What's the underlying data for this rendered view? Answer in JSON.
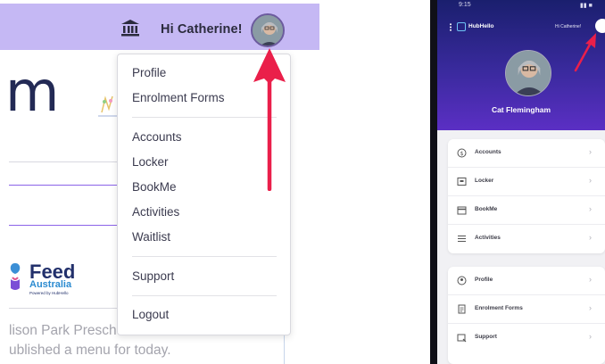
{
  "desktop": {
    "greeting": "Hi Catherine!",
    "logo_partial": "m",
    "feed": {
      "title": "Feed",
      "subtitle": "Australia",
      "powered": "Powered by HubHello"
    },
    "menu_note_line1": "lison Park Preschool has not",
    "menu_note_line2": "ublished a menu for today.",
    "dropdown": {
      "items_group1": [
        "Profile",
        "Enrolment Forms"
      ],
      "items_group2": [
        "Accounts",
        "Locker",
        "BookMe",
        "Activities",
        "Waitlist"
      ],
      "items_group3": [
        "Support"
      ],
      "items_group4": [
        "Logout"
      ]
    }
  },
  "phone": {
    "status_time": "9:15",
    "status_icons": "▮▮ ■",
    "app_name": "HubHello",
    "greeting": "Hi Catherine!",
    "user_name": "Cat Flemingham",
    "card1": [
      {
        "label": "Accounts",
        "icon": "dollar-circle-icon"
      },
      {
        "label": "Locker",
        "icon": "locker-icon"
      },
      {
        "label": "BookMe",
        "icon": "calendar-icon"
      },
      {
        "label": "Activities",
        "icon": "list-icon"
      }
    ],
    "card2": [
      {
        "label": "Profile",
        "icon": "user-circle-icon"
      },
      {
        "label": "Enrolment Forms",
        "icon": "form-icon"
      },
      {
        "label": "Support",
        "icon": "support-icon"
      }
    ],
    "chevron": "›"
  },
  "colors": {
    "topbar": "#c5b8f4",
    "arrow": "#ea1f4a",
    "header_gradient_top": "#1a1f6e",
    "header_gradient_bottom": "#5b2fc4"
  }
}
